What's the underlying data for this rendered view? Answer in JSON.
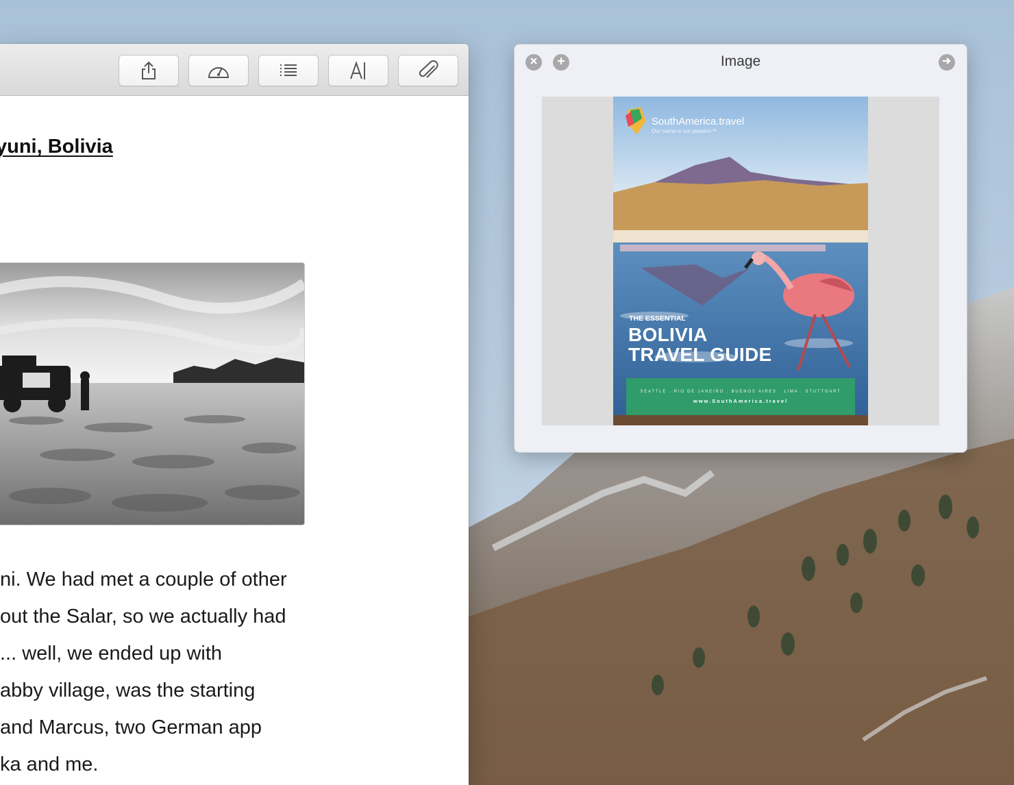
{
  "editor": {
    "toolbar": {
      "share_icon": "share-icon",
      "stats_icon": "speedometer-icon",
      "list_icon": "list-icon",
      "font_icon": "font-icon",
      "attach_icon": "paperclip-icon"
    },
    "heading": "yuni, Bolivia",
    "body_lines": [
      "ni. We had met a couple of other",
      "out the Salar, so we actually had",
      "... well, we ended up with",
      "abby village, was the starting",
      "and Marcus, two German app",
      "ka and me."
    ]
  },
  "image_panel": {
    "title": "Image",
    "controls": [
      "close-icon",
      "zoom-in-icon",
      "forward-icon"
    ],
    "cover": {
      "brand": "SouthAmerica.travel",
      "tagline": "Our name is our passion™",
      "kicker": "THE ESSENTIAL",
      "title_line1": "BOLIVIA",
      "title_line2": "TRAVEL GUIDE",
      "cities": "SEATTLE . RIO DE JANEIRO . BUENOS AIRES . LIMA . STUTTGART",
      "url": "www.SouthAmerica.travel"
    }
  },
  "colors": {
    "sky": "#9fb9d2",
    "cover_band": "#2f9c6a"
  }
}
